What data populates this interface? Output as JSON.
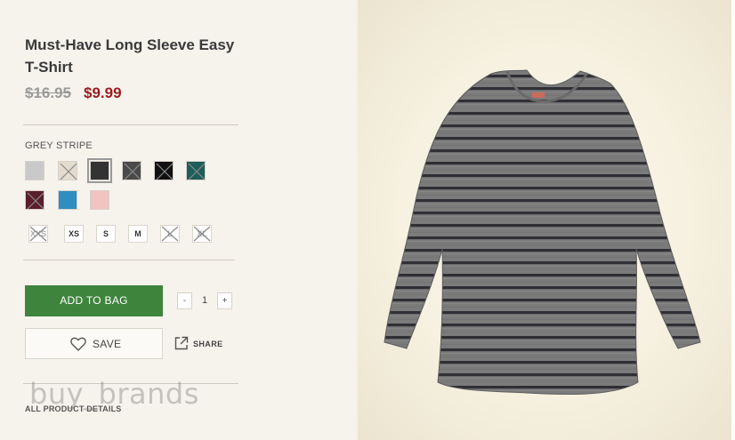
{
  "product": {
    "title": "Must-Have Long Sleeve Easy T-Shirt",
    "original_price": "$16.95",
    "sale_price": "$9.99",
    "selected_color": "GREY STRIPE"
  },
  "swatches": [
    {
      "name": "swatch-1",
      "color": "#c9c9c9",
      "available": true
    },
    {
      "name": "swatch-2",
      "color": "#e4dccf",
      "available": false
    },
    {
      "name": "swatch-3",
      "color": "#333333",
      "available": true,
      "selected": true
    },
    {
      "name": "swatch-4",
      "color": "#4a4a4a",
      "available": false
    },
    {
      "name": "swatch-5",
      "color": "#111111",
      "available": false
    },
    {
      "name": "swatch-6",
      "color": "#1e5e58",
      "available": false
    },
    {
      "name": "swatch-7",
      "color": "#5a1f2b",
      "available": false
    },
    {
      "name": "swatch-8",
      "color": "#2f8dc0",
      "available": true
    },
    {
      "name": "swatch-9",
      "color": "#f1c3c1",
      "available": true
    }
  ],
  "sizes": [
    {
      "label": "XXS",
      "available": false
    },
    {
      "label": "XS",
      "available": true
    },
    {
      "label": "S",
      "available": true
    },
    {
      "label": "M",
      "available": true
    },
    {
      "label": "L",
      "available": false
    },
    {
      "label": "XL",
      "available": false
    }
  ],
  "actions": {
    "add_to_bag": "ADD TO BAG",
    "quantity": "1",
    "qty_minus": "-",
    "qty_plus": "+",
    "save": "SAVE",
    "share": "SHARE",
    "all_details": "ALL PRODUCT DETAILS"
  },
  "watermark": "buy_brands",
  "icons": [
    "heart-icon",
    "share-icon",
    "unavailable-x-icon"
  ]
}
